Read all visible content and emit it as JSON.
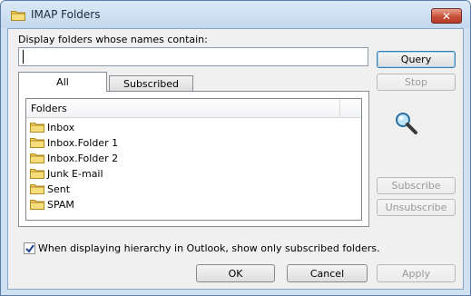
{
  "window": {
    "title": "IMAP Folders",
    "close_glyph": "✕"
  },
  "filter": {
    "label": "Display folders whose names contain:",
    "value": ""
  },
  "buttons": {
    "query": "Query",
    "stop": "Stop",
    "subscribe": "Subscribe",
    "unsubscribe": "Unsubscribe",
    "ok": "OK",
    "cancel": "Cancel",
    "apply": "Apply"
  },
  "tabs": {
    "all": "All",
    "subscribed": "Subscribed"
  },
  "folder_list": {
    "column_header": "Folders",
    "items": [
      {
        "label": "Inbox"
      },
      {
        "label": "Inbox.Folder 1"
      },
      {
        "label": "Inbox.Folder 2"
      },
      {
        "label": "Junk E-mail"
      },
      {
        "label": "Sent"
      },
      {
        "label": "SPAM"
      }
    ]
  },
  "options": {
    "show_subscribed_only_label": "When displaying hierarchy in Outlook, show only subscribed folders.",
    "show_subscribed_only_checked": true
  },
  "icons": {
    "folder": "folder-icon",
    "search": "magnifier-icon",
    "check": "checkmark-icon"
  },
  "colors": {
    "window_frame": "#cfe0f2",
    "dialog_bg": "#f0f0f0",
    "folder_yellow": "#f3cf5c",
    "close_red": "#c8503a"
  }
}
